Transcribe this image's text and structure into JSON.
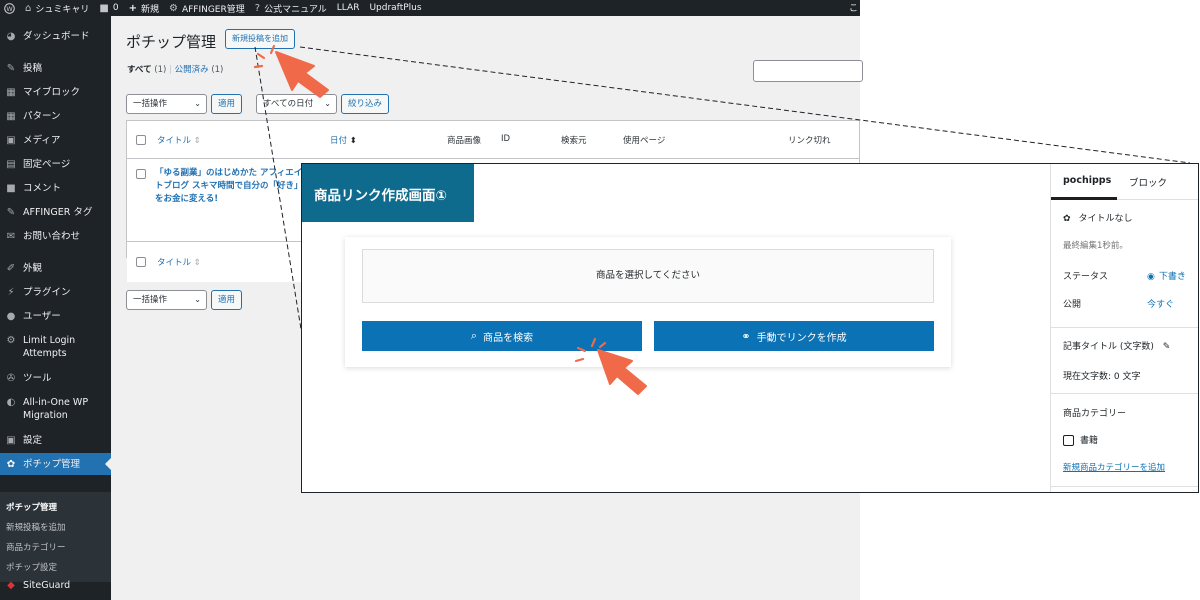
{
  "adminbar": {
    "site_name": "シュミキャリ",
    "comments_count": "0",
    "new_label": "新規",
    "affinger_label": "AFFINGER管理",
    "manual_label": "公式マニュアル",
    "llar_label": "LLAR",
    "updraft_label": "UpdraftPlus",
    "right_text": "こ"
  },
  "sidebar": {
    "items": [
      {
        "label": "ダッシュボード",
        "icon": "dashboard-icon"
      },
      {
        "label": "投稿",
        "icon": "pin-icon"
      },
      {
        "label": "マイブロック",
        "icon": "blocks-icon"
      },
      {
        "label": "パターン",
        "icon": "blocks-icon"
      },
      {
        "label": "メディア",
        "icon": "media-icon"
      },
      {
        "label": "固定ページ",
        "icon": "page-icon"
      },
      {
        "label": "コメント",
        "icon": "comment-icon"
      },
      {
        "label": "AFFINGER タグ",
        "icon": "pin-icon"
      },
      {
        "label": "お問い合わせ",
        "icon": "mail-icon"
      },
      {
        "label": "外観",
        "icon": "brush-icon"
      },
      {
        "label": "プラグイン",
        "icon": "plugin-icon"
      },
      {
        "label": "ユーザー",
        "icon": "user-icon"
      },
      {
        "label": "Limit Login Attempts",
        "icon": "gear-icon"
      },
      {
        "label": "ツール",
        "icon": "wrench-icon"
      },
      {
        "label": "All-in-One WP Migration",
        "icon": "migration-icon"
      },
      {
        "label": "設定",
        "icon": "settings-icon"
      },
      {
        "label": "ポチップ管理",
        "icon": "paw-icon"
      }
    ],
    "submenu": [
      "ポチップ管理",
      "新規投稿を追加",
      "商品カテゴリー",
      "ポチップ設定"
    ],
    "footer_item": "SiteGuard"
  },
  "main": {
    "page_title": "ポチップ管理",
    "add_new_label": "新規投稿を追加",
    "filter_all": "すべて",
    "filter_all_count": "(1)",
    "filter_separator": "|",
    "filter_published": "公開済み",
    "filter_published_count": "(1)",
    "bulk_action": "一括操作",
    "apply": "適用",
    "all_dates": "すべての日付",
    "filter_button": "絞り込み",
    "columns": [
      "タイトル",
      "日付",
      "商品画像",
      "ID",
      "検索元",
      "使用ページ",
      "リンク切れ"
    ],
    "row_title": "「ゆる副業」のはじめかた アフィエイトブログ スキマ時間で自分の「好き」をお金に変える!",
    "footer_column_title": "タイトル"
  },
  "zoom": {
    "title": "商品リンク作成画面①",
    "select_prompt": "商品を選択してください",
    "search_button": "商品を検索",
    "manual_button": "手動でリンクを作成",
    "side": {
      "tab_1": "pochipps",
      "tab_2": "ブロック",
      "post_title": "タイトルなし",
      "last_edited": "最終編集1秒前。",
      "status_label": "ステータス",
      "status_value": "下書き",
      "publish_label": "公開",
      "publish_value": "今すぐ",
      "title_count_label": "記事タイトル (文字数)",
      "current_count": "現在文字数: 0 文字",
      "category_label": "商品カテゴリー",
      "category_item": "書籍",
      "add_category_link": "新規商品カテゴリーを追加"
    }
  },
  "colors": {
    "accent": "#2271b1",
    "admin_dark": "#1d2327",
    "title_banner": "#0f6b8d",
    "cta_blue": "#0b72b5",
    "pointer": "#f06a4a"
  }
}
